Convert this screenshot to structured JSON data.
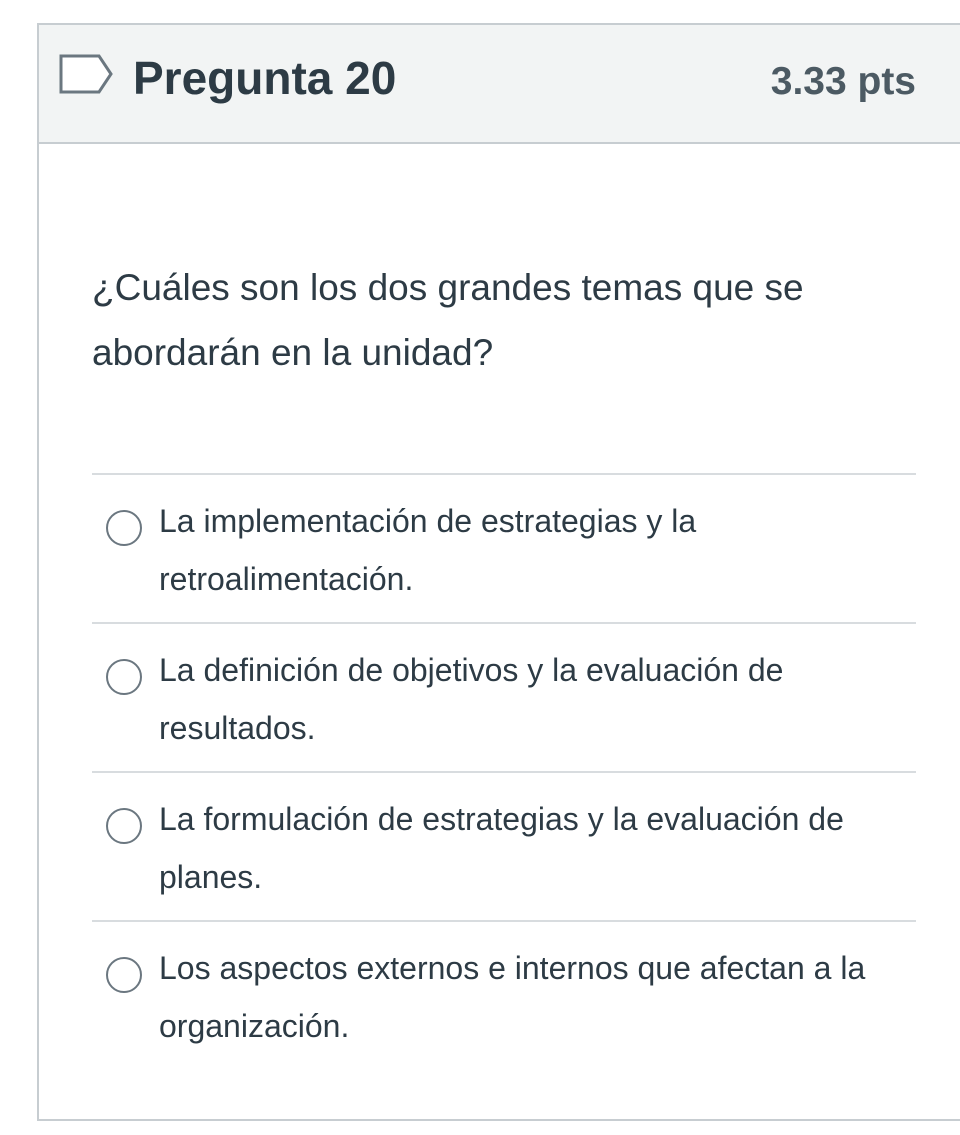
{
  "question": {
    "title": "Pregunta 20",
    "points": "3.33 pts",
    "flag_icon": "flag-outline-icon",
    "text": "¿Cuáles son los dos grandes temas que se abordarán en la unidad?"
  },
  "answers": [
    {
      "label": "La implementación de estrategias y la retroalimentación.",
      "selected": false
    },
    {
      "label": "La definición de objetivos y la evaluación de resultados.",
      "selected": false
    },
    {
      "label": "La formulación de estrategias y la evaluación de planes.",
      "selected": false
    },
    {
      "label": "Los aspectos externos e internos que afectan a la organización.",
      "selected": false
    }
  ],
  "colors": {
    "header_bg": "#f2f4f4",
    "border": "#c7cdd1",
    "text": "#2d3b45",
    "muted_text": "#4c5a63",
    "radio_border": "#6b7780"
  }
}
